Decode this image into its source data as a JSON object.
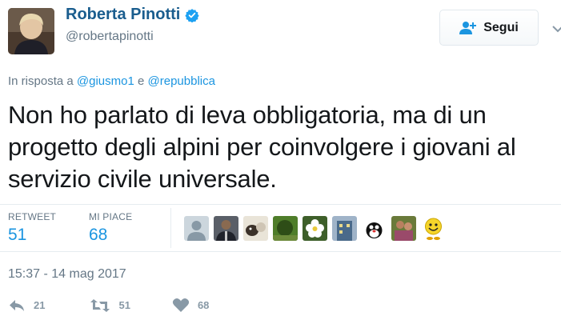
{
  "user": {
    "display_name": "Roberta Pinotti",
    "handle": "@robertapinotti"
  },
  "follow_button": {
    "label": "Segui"
  },
  "reply_context": {
    "prefix": "In risposta a",
    "mention1": "@giusmo1",
    "joiner": "e",
    "mention2": "@repubblica"
  },
  "tweet": {
    "text": "Non ho parlato di leva obbligatoria, ma di un progetto degli alpini per coinvolgere i giovani al servizio civile universale."
  },
  "stats": {
    "retweets_label": "RETWEET",
    "retweets_value": "51",
    "likes_label": "MI PIACE",
    "likes_value": "68"
  },
  "likers": [
    "default-avatar",
    "man-suit-avatar",
    "animals-avatar",
    "nature-avatar",
    "flower-avatar",
    "building-avatar",
    "cartoon-cat-avatar",
    "people-avatar",
    "smiley-avatar"
  ],
  "timestamp": "15:37 - 14 mag 2017",
  "actions": {
    "reply_count": "21",
    "retweet_count": "51",
    "like_count": "68"
  },
  "colors": {
    "name": "#1a5d8e",
    "link": "#1b95e0",
    "muted": "#657786",
    "icon": "#8899a6",
    "verified": "#1da1f2"
  }
}
